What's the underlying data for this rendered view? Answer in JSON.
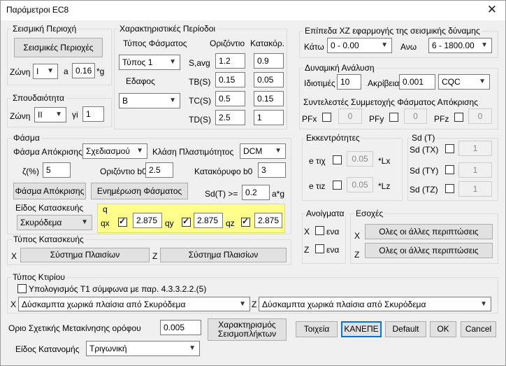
{
  "window": {
    "title": "Παράμετροι EC8",
    "close_symbol": "✕"
  },
  "seismic_region": {
    "group": "Σεισμική Περιοχή",
    "button": "Σεισμικές Περιοχές",
    "zone_label": "Ζώνη",
    "zone_value": "I",
    "a_label": "a",
    "a_value": "0.16",
    "a_unit": "*g"
  },
  "importance": {
    "group": "Σπουδαιότητα",
    "zone_label": "Ζώνη",
    "zone_value": "II",
    "gi_label": "γi",
    "gi_value": "1"
  },
  "periods": {
    "group": "Χαρακτηριστικές Περίοδοι",
    "spectrum_type_label": "Τύπος Φάσματος",
    "spectrum_type_value": "Τύπος 1",
    "soil_label": "Εδαφος",
    "soil_value": "B",
    "col_horizontal": "Οριζόντιο",
    "col_vertical": "Κατακόρ.",
    "rows": [
      {
        "label": "S,avg",
        "h": "1.2",
        "v": "0.9"
      },
      {
        "label": "TB(S)",
        "h": "0.15",
        "v": "0.05"
      },
      {
        "label": "TC(S)",
        "h": "0.5",
        "v": "0.15"
      },
      {
        "label": "TD(S)",
        "h": "2.5",
        "v": "1"
      }
    ]
  },
  "levels": {
    "group": "Επίπεδα XZ εφαρμογής της σεισμικής δύναμης",
    "bottom_label": "Κάτω",
    "bottom_value": "0 - 0.00",
    "top_label": "Ανω",
    "top_value": "6 - 1800.00"
  },
  "dynamic": {
    "group": "Δυναμική Ανάλυση",
    "modes_label": "Ιδιοτιμές",
    "modes_value": "10",
    "accuracy_label": "Ακρίβεια",
    "accuracy_value": "0.001",
    "method_value": "CQC"
  },
  "participation": {
    "group": "Συντελεστές Συμμετοχής Φάσματος Απόκρισης",
    "items": [
      {
        "label": "PFx",
        "value": "0"
      },
      {
        "label": "PFy",
        "value": "0"
      },
      {
        "label": "PFz",
        "value": "0"
      }
    ]
  },
  "spectrum": {
    "group": "Φάσμα",
    "response_label": "Φάσμα Απόκρισης",
    "response_value": "Σχεδιασμού",
    "ductility_label": "Κλάση Πλαστιμότητος",
    "ductility_value": "DCM",
    "zeta_label": "ζ(%)",
    "zeta_value": "5",
    "horizontal_b0_label": "Οριζόντιο b0",
    "horizontal_b0_value": "2.5",
    "vertical_b0_label": "Κατακόρυφο b0",
    "vertical_b0_value": "3",
    "response_button": "Φάσμα Απόκρισης",
    "update_button": "Ενημέρωση Φάσματος",
    "sd_label": "Sd(T) >=",
    "sd_value": "0.2",
    "sd_unit": "a*g",
    "construction_label": "Είδος Κατασκευής",
    "construction_value": "Σκυρόδεμα",
    "q_label": "q",
    "qx_label": "qx",
    "qx_value": "2.875",
    "qy_label": "qy",
    "qy_value": "2.875",
    "qz_label": "qz",
    "qz_value": "2.875"
  },
  "eccentricities": {
    "group": "Εκκεντρότητες",
    "items": [
      {
        "label": "e τιχ",
        "value": "0.05",
        "unit": "*Lx"
      },
      {
        "label": "e τιz",
        "value": "0.05",
        "unit": "*Lz"
      }
    ]
  },
  "sd_group": {
    "group": "Sd (T)",
    "items": [
      {
        "label": "Sd (TX)",
        "value": "1"
      },
      {
        "label": "Sd (TY)",
        "value": "1"
      },
      {
        "label": "Sd (TZ)",
        "value": "1"
      }
    ]
  },
  "openings": {
    "group": "Ανοίγματα",
    "x_label": "X",
    "z_label": "Z",
    "x_check_label": "ενα",
    "z_check_label": "ενα"
  },
  "recesses": {
    "group": "Εσοχές",
    "x_label": "X",
    "z_label": "Z",
    "x_button": "Ολες οι άλλες περιπτώσεις",
    "z_button": "Ολες οι άλλες περιπτώσεις"
  },
  "structure_type": {
    "group": "Τύπος Κατασκευής",
    "x_label": "X",
    "z_label": "Z",
    "x_button": "Σύστημα Πλαισίων",
    "z_button": "Σύστημα Πλαισίων"
  },
  "building_type": {
    "group": "Τύπος Κτιρίου",
    "t1_check": "Υπολογισμός T1 σύμφωνα με παρ. 4.3.3.2.2.(5)",
    "x_label": "X",
    "x_value": "Δύσκαμπτα χωρικά πλαίσια από Σκυρόδεμα",
    "z_label": "Z",
    "z_value": "Δύσκαμπτα χωρικά πλαίσια από Σκυρόδεμα"
  },
  "bottom": {
    "drift_label": "Οριο Σχετικής Μετακίνησης ορόφου",
    "drift_value": "0.005",
    "distribution_label": "Είδος Κατανομής",
    "distribution_value": "Τριγωνική",
    "buttons": {
      "characterization": "Χαρακτηρισμός\nΣεισμοπλήκτων",
      "walls": "Τοιχεία",
      "none": "ΚΑΝΕΠΕ",
      "default": "Default",
      "ok": "OK",
      "cancel": "Cancel"
    }
  }
}
